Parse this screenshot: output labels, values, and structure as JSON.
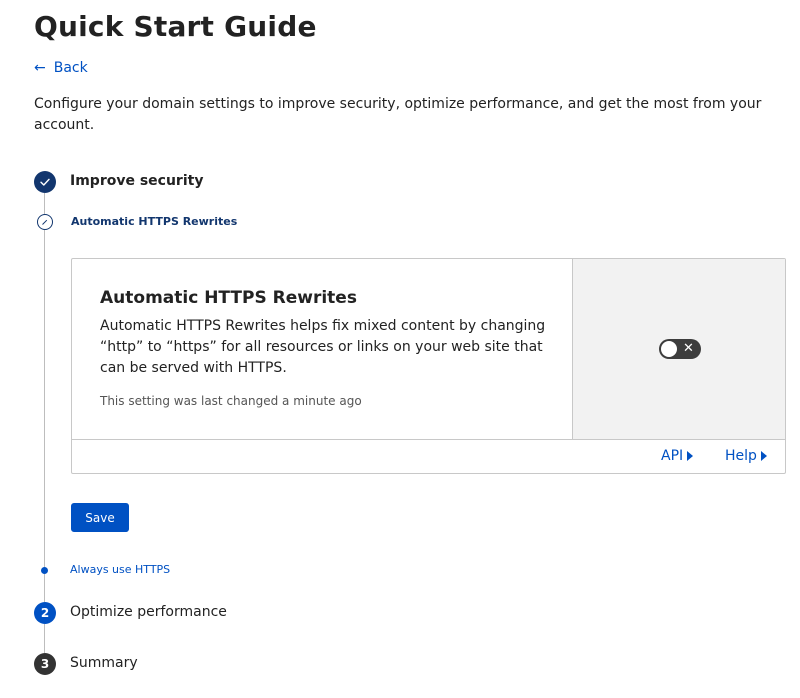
{
  "page": {
    "title": "Quick Start Guide",
    "back_label": "Back",
    "intro": "Configure your domain settings to improve security, optimize performance, and get the most from your account."
  },
  "steps": [
    {
      "label": "Improve security",
      "status": "completed"
    },
    {
      "number": "2",
      "label": "Optimize performance",
      "status": "upcoming"
    },
    {
      "number": "3",
      "label": "Summary",
      "status": "upcoming"
    }
  ],
  "substeps": {
    "current": "Automatic HTTPS Rewrites",
    "next": "Always use HTTPS"
  },
  "card": {
    "title": "Automatic HTTPS Rewrites",
    "description": "Automatic HTTPS Rewrites helps fix mixed content by changing “http” to “https” for all resources or links on your web site that can be served with HTTPS.",
    "meta": "This setting was last changed a minute ago",
    "toggle_state": "off",
    "api_label": "API",
    "help_label": "Help"
  },
  "save_label": "Save",
  "colors": {
    "accent": "#0051c3",
    "step_done": "#12366e",
    "toggle_off": "#3d3d3d"
  }
}
